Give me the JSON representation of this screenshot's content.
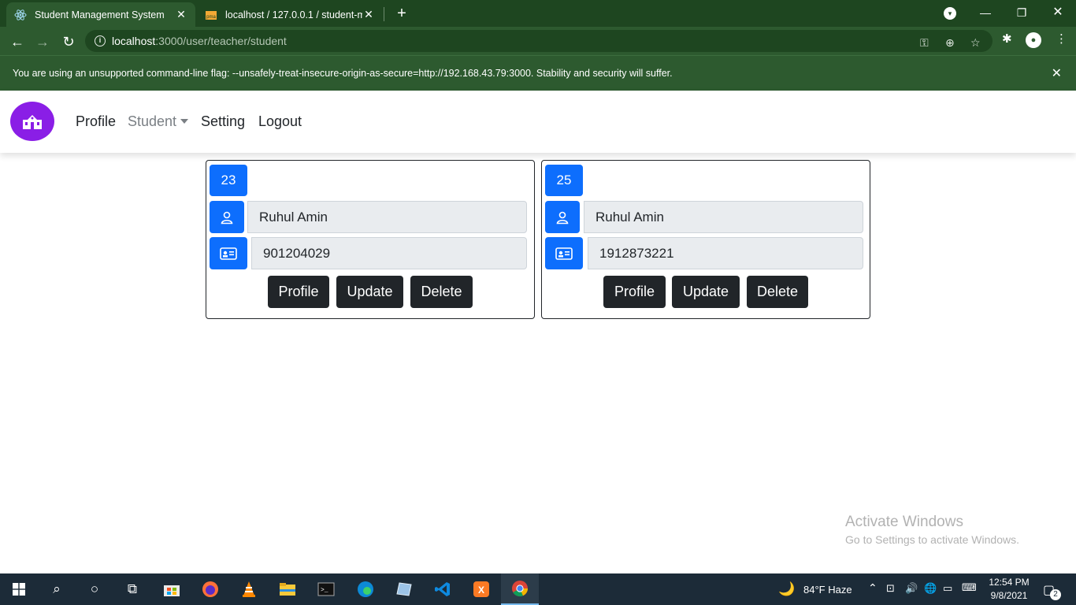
{
  "browser": {
    "tabs": [
      {
        "title": "Student Management System",
        "active": true
      },
      {
        "title": "localhost / 127.0.0.1 / student-m",
        "active": false
      }
    ],
    "url_host": "localhost",
    "url_path": ":3000/user/teacher/student",
    "infobar_text": "You are using an unsupported command-line flag: --unsafely-treat-insecure-origin-as-secure=http://192.168.43.79:3000. Stability and security will suffer."
  },
  "navbar": {
    "links": [
      "Profile",
      "Student",
      "Setting",
      "Logout"
    ]
  },
  "students": [
    {
      "id": "23",
      "name": "Ruhul Amin",
      "phone": "901204029"
    },
    {
      "id": "25",
      "name": "Ruhul Amin",
      "phone": "1912873221"
    }
  ],
  "card_buttons": {
    "profile": "Profile",
    "update": "Update",
    "delete": "Delete"
  },
  "watermark": {
    "title": "Activate Windows",
    "subtitle": "Go to Settings to activate Windows."
  },
  "taskbar": {
    "weather": "84°F  Haze",
    "time": "12:54 PM",
    "date": "9/8/2021",
    "notification_count": "2"
  },
  "colors": {
    "primary": "#0d6efd",
    "dark": "#212529",
    "brand": "#8a1ee6",
    "chrome": "#2d5a2f"
  }
}
